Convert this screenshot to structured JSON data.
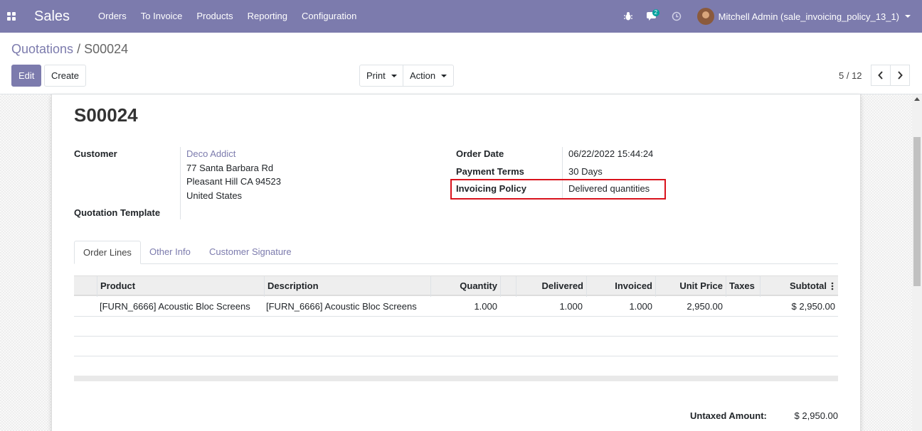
{
  "navbar": {
    "brand": "Sales",
    "menu": [
      "Orders",
      "To Invoice",
      "Products",
      "Reporting",
      "Configuration"
    ],
    "messages_badge": "2",
    "user_name": "Mitchell Admin (sale_invoicing_policy_13_1)"
  },
  "breadcrumb": {
    "parent": "Quotations",
    "separator": "/",
    "current": "S00024"
  },
  "buttons": {
    "edit": "Edit",
    "create": "Create",
    "print": "Print",
    "action": "Action"
  },
  "pager": {
    "text": "5 / 12"
  },
  "form": {
    "title": "S00024",
    "customer_label": "Customer",
    "customer_name": "Deco Addict",
    "address_line1": "77 Santa Barbara Rd",
    "address_line2": "Pleasant Hill CA 94523",
    "address_line3": "United States",
    "quotation_template_label": "Quotation Template",
    "order_date_label": "Order Date",
    "order_date": "06/22/2022 15:44:24",
    "payment_terms_label": "Payment Terms",
    "payment_terms": "30 Days",
    "invoicing_policy_label": "Invoicing Policy",
    "invoicing_policy": "Delivered quantities"
  },
  "tabs": [
    "Order Lines",
    "Other Info",
    "Customer Signature"
  ],
  "table": {
    "headers": {
      "product": "Product",
      "description": "Description",
      "quantity": "Quantity",
      "delivered": "Delivered",
      "invoiced": "Invoiced",
      "unit_price": "Unit Price",
      "taxes": "Taxes",
      "subtotal": "Subtotal"
    },
    "rows": [
      {
        "product": "[FURN_6666] Acoustic Bloc Screens",
        "description": "[FURN_6666] Acoustic Bloc Screens",
        "quantity": "1.000",
        "delivered": "1.000",
        "invoiced": "1.000",
        "unit_price": "2,950.00",
        "taxes": "",
        "subtotal": "$ 2,950.00"
      }
    ]
  },
  "totals": {
    "untaxed_label": "Untaxed Amount:",
    "untaxed_value": "$ 2,950.00"
  },
  "colors": {
    "navbar": "#7c7bad",
    "highlight": "#d9121c"
  }
}
